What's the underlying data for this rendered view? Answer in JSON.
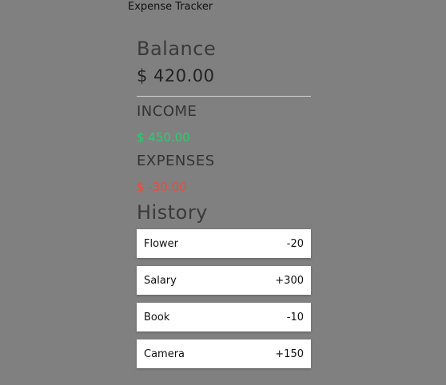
{
  "app": {
    "title": "Expense Tracker"
  },
  "balance": {
    "label": "Balance",
    "value": "$ 420.00"
  },
  "income": {
    "label": "INCOME",
    "value": "$ 450.00"
  },
  "expenses": {
    "label": "EXPENSES",
    "value": "$ -30.00"
  },
  "history": {
    "label": "History",
    "items": [
      {
        "name": "Flower",
        "amount": "-20"
      },
      {
        "name": "Salary",
        "amount": "+300"
      },
      {
        "name": "Book",
        "amount": "-10"
      },
      {
        "name": "Camera",
        "amount": "+150"
      }
    ]
  },
  "colors": {
    "background": "#808080",
    "income": "#2ecc71",
    "expense": "#e74c3c"
  }
}
